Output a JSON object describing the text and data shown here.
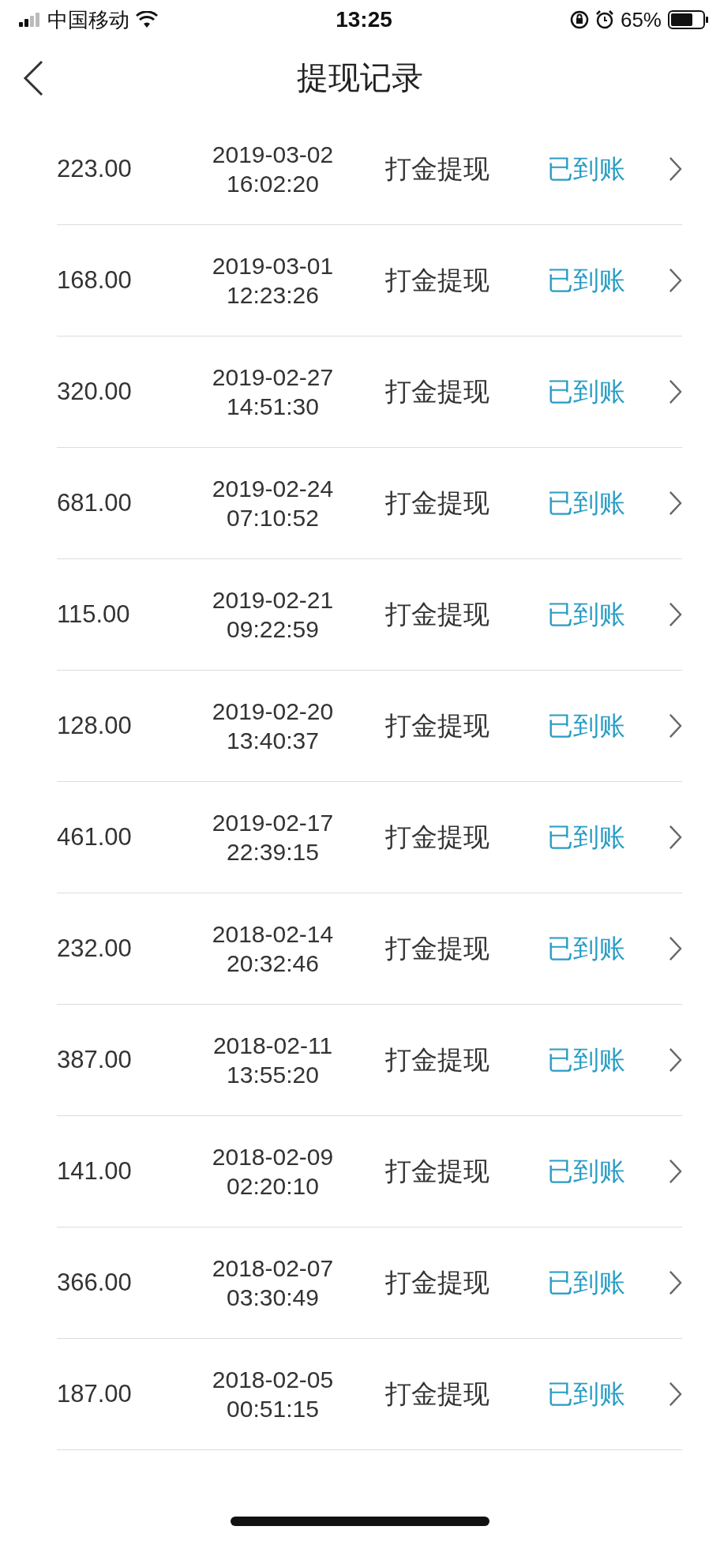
{
  "status_bar": {
    "carrier": "中国移动",
    "time": "13:25",
    "battery": "65%"
  },
  "nav": {
    "title": "提现记录"
  },
  "records": [
    {
      "amount": "223.00",
      "date": "2019-03-02",
      "time": "16:02:20",
      "type": "打金提现",
      "status": "已到账"
    },
    {
      "amount": "168.00",
      "date": "2019-03-01",
      "time": "12:23:26",
      "type": "打金提现",
      "status": "已到账"
    },
    {
      "amount": "320.00",
      "date": "2019-02-27",
      "time": "14:51:30",
      "type": "打金提现",
      "status": "已到账"
    },
    {
      "amount": "681.00",
      "date": "2019-02-24",
      "time": "07:10:52",
      "type": "打金提现",
      "status": "已到账"
    },
    {
      "amount": "115.00",
      "date": "2019-02-21",
      "time": "09:22:59",
      "type": "打金提现",
      "status": "已到账"
    },
    {
      "amount": "128.00",
      "date": "2019-02-20",
      "time": "13:40:37",
      "type": "打金提现",
      "status": "已到账"
    },
    {
      "amount": "461.00",
      "date": "2019-02-17",
      "time": "22:39:15",
      "type": "打金提现",
      "status": "已到账"
    },
    {
      "amount": "232.00",
      "date": "2018-02-14",
      "time": "20:32:46",
      "type": "打金提现",
      "status": "已到账"
    },
    {
      "amount": "387.00",
      "date": "2018-02-11",
      "time": "13:55:20",
      "type": "打金提现",
      "status": "已到账"
    },
    {
      "amount": "141.00",
      "date": "2018-02-09",
      "time": "02:20:10",
      "type": "打金提现",
      "status": "已到账"
    },
    {
      "amount": "366.00",
      "date": "2018-02-07",
      "time": "03:30:49",
      "type": "打金提现",
      "status": "已到账"
    },
    {
      "amount": "187.00",
      "date": "2018-02-05",
      "time": "00:51:15",
      "type": "打金提现",
      "status": "已到账"
    }
  ]
}
